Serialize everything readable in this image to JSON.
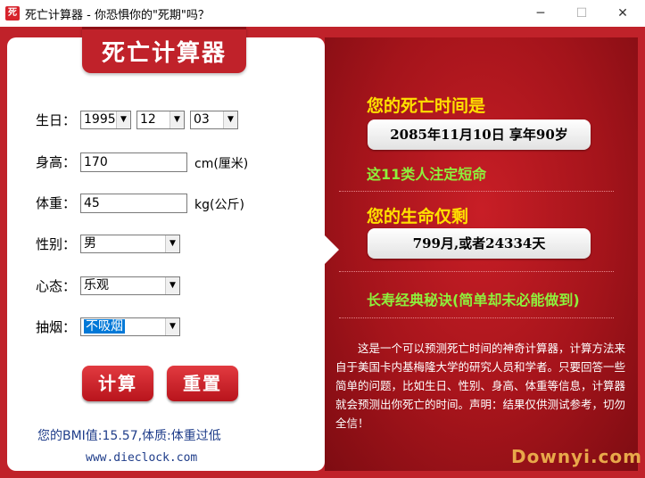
{
  "window": {
    "title": "死亡计算器 - 你恐惧你的\"死期\"吗？",
    "icon_glyph": "死",
    "minimize_glyph": "─",
    "maximize_glyph": "☐",
    "close_glyph": "✕"
  },
  "logo": {
    "text": "死亡计算器"
  },
  "form": {
    "birthday": {
      "label": "生日：",
      "year": "1995",
      "month": "12",
      "day": "03"
    },
    "height": {
      "label": "身高：",
      "value": "170",
      "unit": "cm(厘米)"
    },
    "weight": {
      "label": "体重：",
      "value": "45",
      "unit": "kg(公斤)"
    },
    "gender": {
      "label": "性别：",
      "value": "男"
    },
    "mood": {
      "label": "心态：",
      "value": "乐观"
    },
    "smoking": {
      "label": "抽烟：",
      "value": "不吸烟"
    },
    "dropdown_glyph": "▼"
  },
  "buttons": {
    "calculate": "计算",
    "reset": "重置"
  },
  "bmi_text": "您的BMI值:15.57,体质:体重过低",
  "url_text": "www.dieclock.com",
  "results": {
    "death_time_heading": "您的死亡时间是",
    "death_time_value": "2085年11月10日  享年90岁",
    "link_1": "这11类人注定短命",
    "remaining_heading": "您的生命仅剩",
    "remaining_value": "799月,或者24334天",
    "link_2": "长寿经典秘诀(简单却未必能做到)"
  },
  "description": "这是一个可以预测死亡时间的神奇计算器，计算方法来自于美国卡内基梅隆大学的研究人员和学者。只要回答一些简单的问题，比如生日、性别、身高、体重等信息，计算器就会预测出你死亡的时间。声明：结果仅供测试参考，切勿全信！",
  "watermark": "Downyi.com",
  "colors": {
    "frame_red": "#c0222a",
    "headline_yellow": "#ffe000",
    "link_green": "#8ef03c",
    "selection_blue": "#0078d7"
  }
}
